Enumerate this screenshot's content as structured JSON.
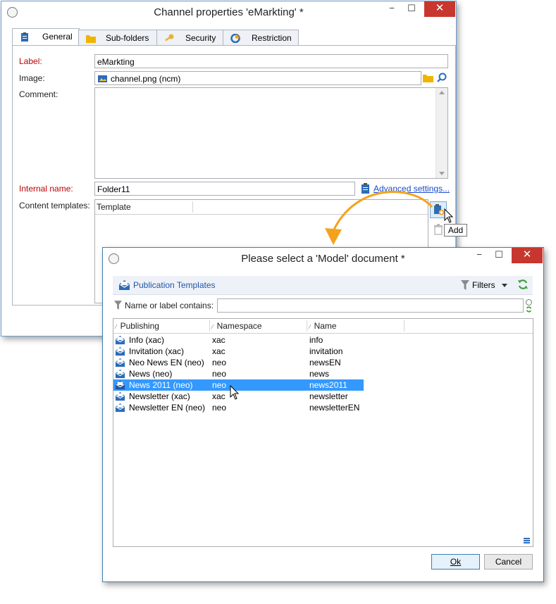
{
  "back_window": {
    "title": "Channel properties 'eMarkting' *",
    "tabs": [
      {
        "label": "General"
      },
      {
        "label": "Sub-folders"
      },
      {
        "label": "Security"
      },
      {
        "label": "Restriction"
      }
    ],
    "label_caption": "Label:",
    "label_value": "eMarkting",
    "image_caption": "Image:",
    "image_value": "channel.png (ncm)",
    "comment_caption": "Comment:",
    "internal_name_caption": "Internal name:",
    "internal_name_value": "Folder11",
    "advanced_settings_link": "Advanced settings...",
    "content_templates_caption": "Content templates:",
    "templates_column": "Template",
    "add_tooltip": "Add"
  },
  "dialog": {
    "title": "Please select a 'Model' document *",
    "folder_label": "Publication Templates",
    "filters_label": "Filters",
    "filter_caption": "Name or label contains:",
    "filter_value": "",
    "columns": [
      "Publishing",
      "Namespace",
      "Name"
    ],
    "rows": [
      {
        "publishing": "Info (xac)",
        "namespace": "xac",
        "name": "info",
        "selected": false
      },
      {
        "publishing": "Invitation (xac)",
        "namespace": "xac",
        "name": "invitation",
        "selected": false
      },
      {
        "publishing": "Neo News EN (neo)",
        "namespace": "neo",
        "name": "newsEN",
        "selected": false
      },
      {
        "publishing": "News (neo)",
        "namespace": "neo",
        "name": "news",
        "selected": false
      },
      {
        "publishing": "News 2011 (neo)",
        "namespace": "neo",
        "name": "news2011",
        "selected": true
      },
      {
        "publishing": "Newsletter (xac)",
        "namespace": "xac",
        "name": "newsletter",
        "selected": false
      },
      {
        "publishing": "Newsletter EN (neo)",
        "namespace": "neo",
        "name": "newsletterEN",
        "selected": false
      }
    ],
    "ok_label": "Ok",
    "cancel_label": "Cancel"
  },
  "window_controls": {
    "minimize": "−",
    "maximize": "☐",
    "close": "✕"
  },
  "colors": {
    "accent_blue": "#2b6cb8",
    "selection": "#3399ff",
    "arrow_orange": "#f5a21b",
    "required_red": "#c00000",
    "close_red": "#c7372f"
  },
  "icons": [
    "clipboard-icon",
    "folder-icon",
    "key-icon",
    "restriction-icon",
    "folder-open-icon",
    "search-icon",
    "add-template-icon",
    "delete-icon",
    "envelope-icon",
    "funnel-icon",
    "refresh-icon",
    "mouse-pointer-icon",
    "curved-arrow-icon"
  ]
}
